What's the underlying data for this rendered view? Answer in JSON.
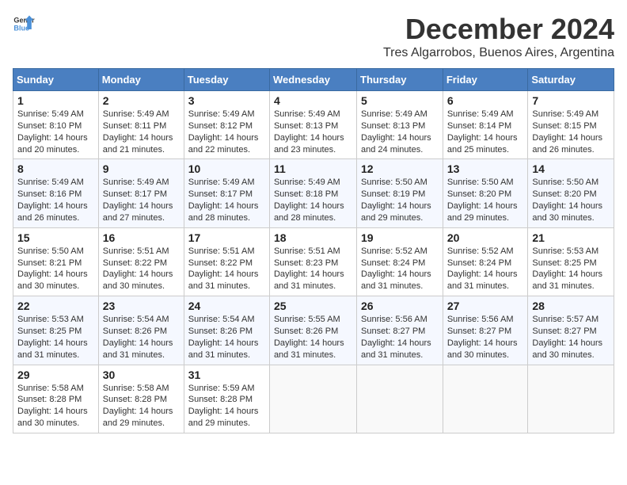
{
  "header": {
    "logo_general": "General",
    "logo_blue": "Blue",
    "month_title": "December 2024",
    "location": "Tres Algarrobos, Buenos Aires, Argentina"
  },
  "calendar": {
    "days_of_week": [
      "Sunday",
      "Monday",
      "Tuesday",
      "Wednesday",
      "Thursday",
      "Friday",
      "Saturday"
    ],
    "weeks": [
      [
        {
          "day": "1",
          "sunrise": "5:49 AM",
          "sunset": "8:10 PM",
          "daylight": "14 hours and 20 minutes."
        },
        {
          "day": "2",
          "sunrise": "5:49 AM",
          "sunset": "8:11 PM",
          "daylight": "14 hours and 21 minutes."
        },
        {
          "day": "3",
          "sunrise": "5:49 AM",
          "sunset": "8:12 PM",
          "daylight": "14 hours and 22 minutes."
        },
        {
          "day": "4",
          "sunrise": "5:49 AM",
          "sunset": "8:13 PM",
          "daylight": "14 hours and 23 minutes."
        },
        {
          "day": "5",
          "sunrise": "5:49 AM",
          "sunset": "8:13 PM",
          "daylight": "14 hours and 24 minutes."
        },
        {
          "day": "6",
          "sunrise": "5:49 AM",
          "sunset": "8:14 PM",
          "daylight": "14 hours and 25 minutes."
        },
        {
          "day": "7",
          "sunrise": "5:49 AM",
          "sunset": "8:15 PM",
          "daylight": "14 hours and 26 minutes."
        }
      ],
      [
        {
          "day": "8",
          "sunrise": "5:49 AM",
          "sunset": "8:16 PM",
          "daylight": "14 hours and 26 minutes."
        },
        {
          "day": "9",
          "sunrise": "5:49 AM",
          "sunset": "8:17 PM",
          "daylight": "14 hours and 27 minutes."
        },
        {
          "day": "10",
          "sunrise": "5:49 AM",
          "sunset": "8:17 PM",
          "daylight": "14 hours and 28 minutes."
        },
        {
          "day": "11",
          "sunrise": "5:49 AM",
          "sunset": "8:18 PM",
          "daylight": "14 hours and 28 minutes."
        },
        {
          "day": "12",
          "sunrise": "5:50 AM",
          "sunset": "8:19 PM",
          "daylight": "14 hours and 29 minutes."
        },
        {
          "day": "13",
          "sunrise": "5:50 AM",
          "sunset": "8:20 PM",
          "daylight": "14 hours and 29 minutes."
        },
        {
          "day": "14",
          "sunrise": "5:50 AM",
          "sunset": "8:20 PM",
          "daylight": "14 hours and 30 minutes."
        }
      ],
      [
        {
          "day": "15",
          "sunrise": "5:50 AM",
          "sunset": "8:21 PM",
          "daylight": "14 hours and 30 minutes."
        },
        {
          "day": "16",
          "sunrise": "5:51 AM",
          "sunset": "8:22 PM",
          "daylight": "14 hours and 30 minutes."
        },
        {
          "day": "17",
          "sunrise": "5:51 AM",
          "sunset": "8:22 PM",
          "daylight": "14 hours and 31 minutes."
        },
        {
          "day": "18",
          "sunrise": "5:51 AM",
          "sunset": "8:23 PM",
          "daylight": "14 hours and 31 minutes."
        },
        {
          "day": "19",
          "sunrise": "5:52 AM",
          "sunset": "8:24 PM",
          "daylight": "14 hours and 31 minutes."
        },
        {
          "day": "20",
          "sunrise": "5:52 AM",
          "sunset": "8:24 PM",
          "daylight": "14 hours and 31 minutes."
        },
        {
          "day": "21",
          "sunrise": "5:53 AM",
          "sunset": "8:25 PM",
          "daylight": "14 hours and 31 minutes."
        }
      ],
      [
        {
          "day": "22",
          "sunrise": "5:53 AM",
          "sunset": "8:25 PM",
          "daylight": "14 hours and 31 minutes."
        },
        {
          "day": "23",
          "sunrise": "5:54 AM",
          "sunset": "8:26 PM",
          "daylight": "14 hours and 31 minutes."
        },
        {
          "day": "24",
          "sunrise": "5:54 AM",
          "sunset": "8:26 PM",
          "daylight": "14 hours and 31 minutes."
        },
        {
          "day": "25",
          "sunrise": "5:55 AM",
          "sunset": "8:26 PM",
          "daylight": "14 hours and 31 minutes."
        },
        {
          "day": "26",
          "sunrise": "5:56 AM",
          "sunset": "8:27 PM",
          "daylight": "14 hours and 31 minutes."
        },
        {
          "day": "27",
          "sunrise": "5:56 AM",
          "sunset": "8:27 PM",
          "daylight": "14 hours and 30 minutes."
        },
        {
          "day": "28",
          "sunrise": "5:57 AM",
          "sunset": "8:27 PM",
          "daylight": "14 hours and 30 minutes."
        }
      ],
      [
        {
          "day": "29",
          "sunrise": "5:58 AM",
          "sunset": "8:28 PM",
          "daylight": "14 hours and 30 minutes."
        },
        {
          "day": "30",
          "sunrise": "5:58 AM",
          "sunset": "8:28 PM",
          "daylight": "14 hours and 29 minutes."
        },
        {
          "day": "31",
          "sunrise": "5:59 AM",
          "sunset": "8:28 PM",
          "daylight": "14 hours and 29 minutes."
        },
        null,
        null,
        null,
        null
      ]
    ]
  }
}
